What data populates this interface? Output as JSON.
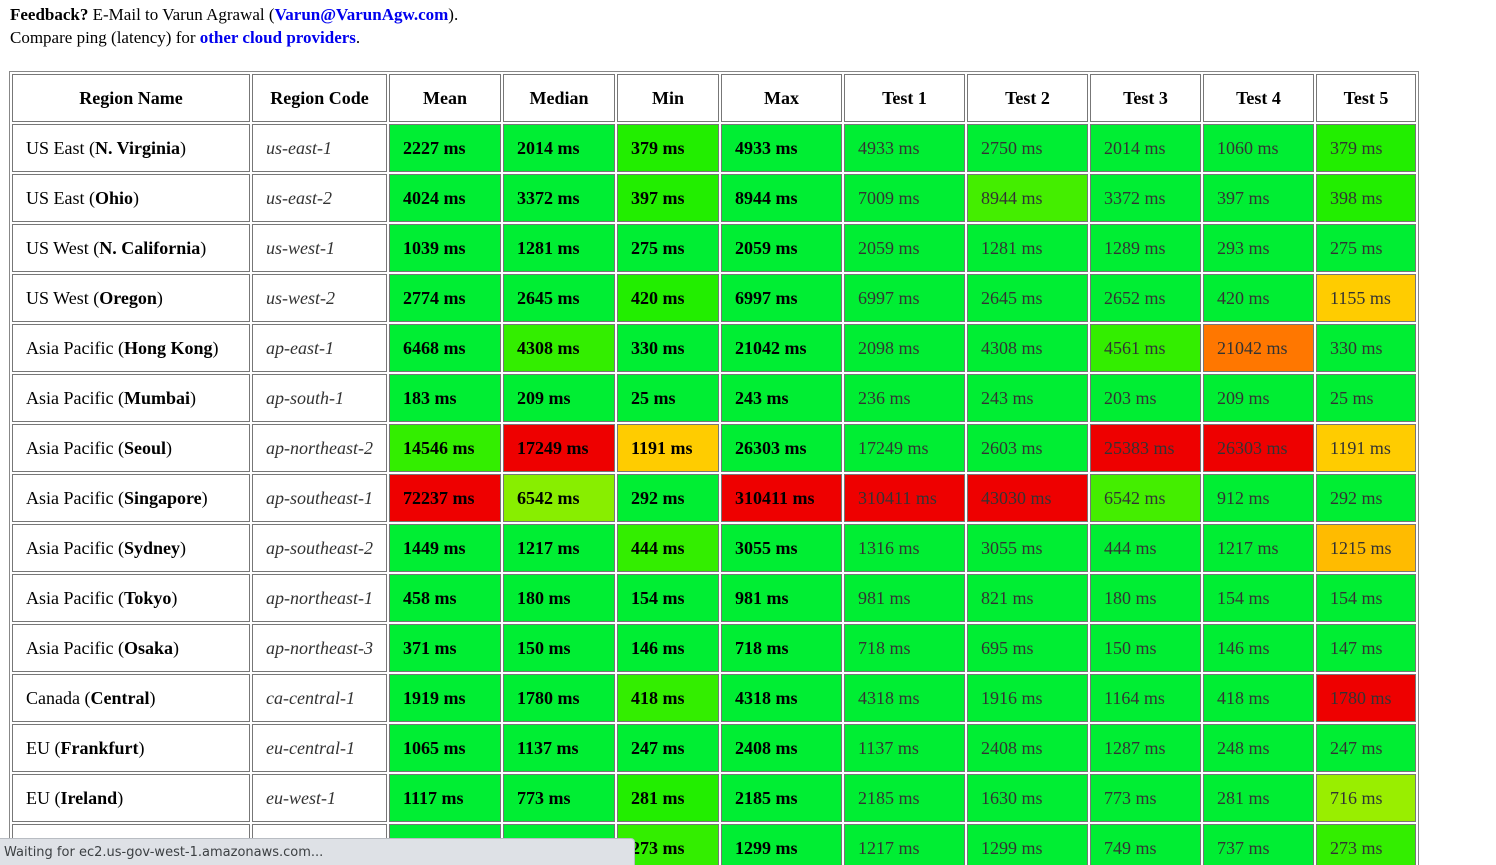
{
  "intro": {
    "feedback_label": "Feedback?",
    "feedback_text": " E-Mail to Varun Agrawal (",
    "email": "Varun@VarunAgw.com",
    "feedback_end": ").",
    "compare_text": "Compare ping (latency) for ",
    "providers_link": "other cloud providers",
    "compare_end": "."
  },
  "table": {
    "headers": [
      "Region Name",
      "Region Code",
      "Mean",
      "Median",
      "Min",
      "Max",
      "Test 1",
      "Test 2",
      "Test 3",
      "Test 4",
      "Test 5"
    ],
    "rows": [
      {
        "prefix": "US East ",
        "place": "N. Virginia",
        "code": "us-east-1",
        "values": [
          "2227 ms",
          "2014 ms",
          "379 ms",
          "4933 ms",
          "4933 ms",
          "2750 ms",
          "2014 ms",
          "1060 ms",
          "379 ms"
        ],
        "colors": [
          "#00ee33",
          "#00ee33",
          "#22ee00",
          "#00ee33",
          "#00ee33",
          "#00ee33",
          "#00ee33",
          "#00ee33",
          "#22ee00"
        ]
      },
      {
        "prefix": "US East ",
        "place": "Ohio",
        "code": "us-east-2",
        "values": [
          "4024 ms",
          "3372 ms",
          "397 ms",
          "8944 ms",
          "7009 ms",
          "8944 ms",
          "3372 ms",
          "397 ms",
          "398 ms"
        ],
        "colors": [
          "#00ee33",
          "#00ee33",
          "#22ee00",
          "#00ee33",
          "#00ee33",
          "#44ee00",
          "#00ee33",
          "#00ee33",
          "#22ee00"
        ]
      },
      {
        "prefix": "US West ",
        "place": "N. California",
        "code": "us-west-1",
        "values": [
          "1039 ms",
          "1281 ms",
          "275 ms",
          "2059 ms",
          "2059 ms",
          "1281 ms",
          "1289 ms",
          "293 ms",
          "275 ms"
        ],
        "colors": [
          "#00ee33",
          "#00ee33",
          "#00ee33",
          "#00ee33",
          "#00ee33",
          "#00ee33",
          "#00ee33",
          "#00ee33",
          "#00ee33"
        ]
      },
      {
        "prefix": "US West ",
        "place": "Oregon",
        "code": "us-west-2",
        "values": [
          "2774 ms",
          "2645 ms",
          "420 ms",
          "6997 ms",
          "6997 ms",
          "2645 ms",
          "2652 ms",
          "420 ms",
          "1155 ms"
        ],
        "colors": [
          "#00ee33",
          "#00ee33",
          "#22ee00",
          "#00ee33",
          "#00ee33",
          "#00ee33",
          "#00ee33",
          "#00ee33",
          "#ffcc00"
        ]
      },
      {
        "prefix": "Asia Pacific ",
        "place": "Hong Kong",
        "code": "ap-east-1",
        "values": [
          "6468 ms",
          "4308 ms",
          "330 ms",
          "21042 ms",
          "2098 ms",
          "4308 ms",
          "4561 ms",
          "21042 ms",
          "330 ms"
        ],
        "colors": [
          "#00ee33",
          "#33ee00",
          "#00ee33",
          "#00ee33",
          "#00ee33",
          "#00ee33",
          "#33ee00",
          "#ff7700",
          "#00ee33"
        ]
      },
      {
        "prefix": "Asia Pacific ",
        "place": "Mumbai",
        "code": "ap-south-1",
        "values": [
          "183 ms",
          "209 ms",
          "25 ms",
          "243 ms",
          "236 ms",
          "243 ms",
          "203 ms",
          "209 ms",
          "25 ms"
        ],
        "colors": [
          "#00ee33",
          "#00ee33",
          "#00ee33",
          "#00ee33",
          "#00ee33",
          "#00ee33",
          "#00ee33",
          "#00ee33",
          "#00ee33"
        ]
      },
      {
        "prefix": "Asia Pacific ",
        "place": "Seoul",
        "code": "ap-northeast-2",
        "values": [
          "14546 ms",
          "17249 ms",
          "1191 ms",
          "26303 ms",
          "17249 ms",
          "2603 ms",
          "25383 ms",
          "26303 ms",
          "1191 ms"
        ],
        "colors": [
          "#33ee00",
          "#ee0000",
          "#ffcc00",
          "#00ee33",
          "#00ee33",
          "#00ee33",
          "#ee0000",
          "#ee0000",
          "#ffcc00"
        ]
      },
      {
        "prefix": "Asia Pacific ",
        "place": "Singapore",
        "code": "ap-southeast-1",
        "values": [
          "72237 ms",
          "6542 ms",
          "292 ms",
          "310411 ms",
          "310411 ms",
          "43030 ms",
          "6542 ms",
          "912 ms",
          "292 ms"
        ],
        "colors": [
          "#ee0000",
          "#88ee00",
          "#00ee33",
          "#ee0000",
          "#ee0000",
          "#ee0000",
          "#44ee00",
          "#00ee33",
          "#00ee33"
        ]
      },
      {
        "prefix": "Asia Pacific ",
        "place": "Sydney",
        "code": "ap-southeast-2",
        "values": [
          "1449 ms",
          "1217 ms",
          "444 ms",
          "3055 ms",
          "1316 ms",
          "3055 ms",
          "444 ms",
          "1217 ms",
          "1215 ms"
        ],
        "colors": [
          "#00ee33",
          "#00ee33",
          "#33ee00",
          "#00ee33",
          "#00ee33",
          "#00ee33",
          "#00ee33",
          "#00ee33",
          "#ffbb00"
        ]
      },
      {
        "prefix": "Asia Pacific ",
        "place": "Tokyo",
        "code": "ap-northeast-1",
        "values": [
          "458 ms",
          "180 ms",
          "154 ms",
          "981 ms",
          "981 ms",
          "821 ms",
          "180 ms",
          "154 ms",
          "154 ms"
        ],
        "colors": [
          "#00ee33",
          "#00ee33",
          "#00ee33",
          "#00ee33",
          "#00ee33",
          "#00ee33",
          "#00ee33",
          "#00ee33",
          "#00ee33"
        ]
      },
      {
        "prefix": "Asia Pacific ",
        "place": "Osaka",
        "code": "ap-northeast-3",
        "values": [
          "371 ms",
          "150 ms",
          "146 ms",
          "718 ms",
          "718 ms",
          "695 ms",
          "150 ms",
          "146 ms",
          "147 ms"
        ],
        "colors": [
          "#00ee33",
          "#00ee33",
          "#00ee33",
          "#00ee33",
          "#00ee33",
          "#00ee33",
          "#00ee33",
          "#00ee33",
          "#00ee33"
        ]
      },
      {
        "prefix": "Canada ",
        "place": "Central",
        "code": "ca-central-1",
        "values": [
          "1919 ms",
          "1780 ms",
          "418 ms",
          "4318 ms",
          "4318 ms",
          "1916 ms",
          "1164 ms",
          "418 ms",
          "1780 ms"
        ],
        "colors": [
          "#00ee33",
          "#00ee33",
          "#33ee00",
          "#00ee33",
          "#00ee33",
          "#00ee33",
          "#00ee33",
          "#00ee33",
          "#ee0000"
        ]
      },
      {
        "prefix": "EU ",
        "place": "Frankfurt",
        "code": "eu-central-1",
        "values": [
          "1065 ms",
          "1137 ms",
          "247 ms",
          "2408 ms",
          "1137 ms",
          "2408 ms",
          "1287 ms",
          "248 ms",
          "247 ms"
        ],
        "colors": [
          "#00ee33",
          "#00ee33",
          "#00ee33",
          "#00ee33",
          "#00ee33",
          "#00ee33",
          "#00ee33",
          "#00ee33",
          "#00ee33"
        ]
      },
      {
        "prefix": "EU ",
        "place": "Ireland",
        "code": "eu-west-1",
        "values": [
          "1117 ms",
          "773 ms",
          "281 ms",
          "2185 ms",
          "2185 ms",
          "1630 ms",
          "773 ms",
          "281 ms",
          "716 ms"
        ],
        "colors": [
          "#00ee33",
          "#00ee33",
          "#22ee00",
          "#00ee33",
          "#00ee33",
          "#00ee33",
          "#00ee33",
          "#00ee33",
          "#99ee00"
        ]
      },
      {
        "prefix": "",
        "place": "",
        "code": "",
        "values": [
          "",
          "",
          "273 ms",
          "1299 ms",
          "1217 ms",
          "1299 ms",
          "749 ms",
          "737 ms",
          "273 ms"
        ],
        "colors": [
          "#00ee33",
          "#00ee33",
          "#33ee00",
          "#00ee33",
          "#00ee33",
          "#00ee33",
          "#00ee33",
          "#00ee33",
          "#33ee00"
        ]
      }
    ]
  },
  "status_bar": {
    "text": "Waiting for ec2.us-gov-west-1.amazonaws.com..."
  }
}
